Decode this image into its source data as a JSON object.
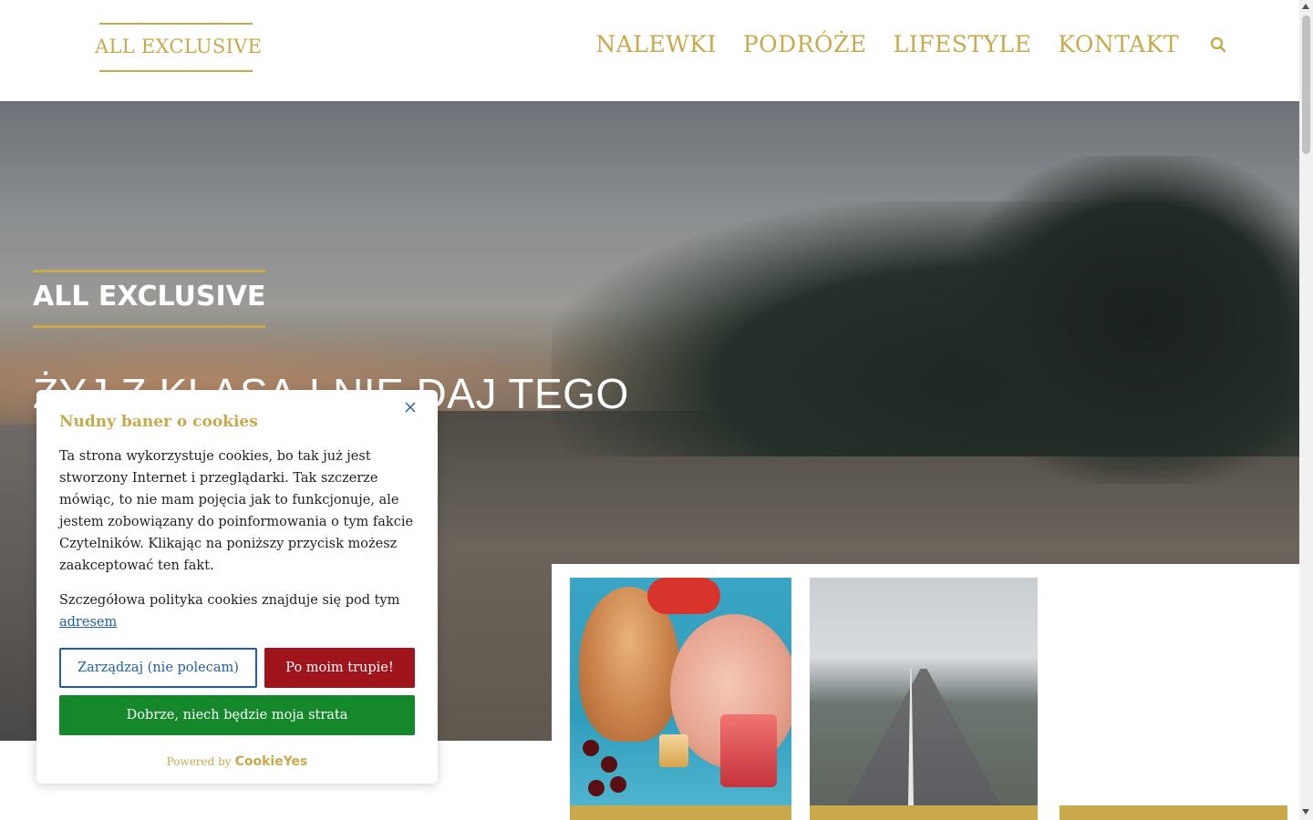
{
  "colors": {
    "accent_gold": "#c9a94c",
    "link_blue": "#1d5fa8",
    "reject_red": "#a0151c",
    "accept_green": "#15882b"
  },
  "header": {
    "logo_text": "ALL EXCLUSIVE",
    "nav": [
      "NALEWKI",
      "PODRÓŻE",
      "LIFESTYLE",
      "KONTAKT"
    ],
    "search_icon": "search-icon"
  },
  "hero": {
    "title": "ALL EXCLUSIVE",
    "tagline": "ŻYJ Z KLASĄ I NIE DAJ TEGO"
  },
  "cookie_banner": {
    "title": "Nudny baner o cookies",
    "paragraph1": "Ta strona wykorzystuje cookies, bo tak już jest stworzony Internet i przeglądarki. Tak szczerze mówiąc, to nie mam pojęcia jak to funkcjonuje, ale jestem zobowiązany do poinformowania o tym fakcie Czytelników. Klikając na poniższy przycisk możesz zaakceptować ten fakt.",
    "paragraph2_text": "Szczegółowa polityka cookies znajduje się pod tym ",
    "paragraph2_link": "adresem",
    "manage_button": "Zarządzaj (nie polecam)",
    "reject_button": "Po moim trupie!",
    "accept_button": "Dobrze, niech będzie moja strata",
    "powered_by": "Powered by",
    "powered_brand": "CookieYes",
    "close_icon": "close-icon"
  }
}
